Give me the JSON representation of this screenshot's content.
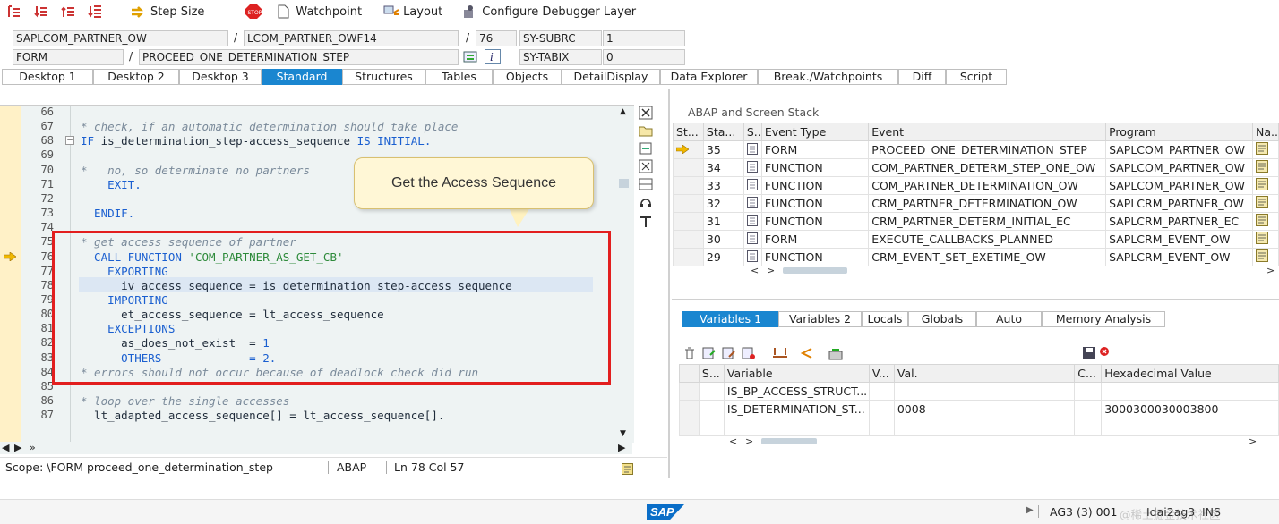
{
  "toolbar": {
    "step_size": "Step Size",
    "watchpoint": "Watchpoint",
    "layout": "Layout",
    "configure_layer": "Configure Debugger Layer"
  },
  "header": {
    "program": "SAPLCOM_PARTNER_OW",
    "include": "LCOM_PARTNER_OWF14",
    "line": "76",
    "sy_subrc_label": "SY-SUBRC",
    "sy_subrc_value": "1",
    "type": "FORM",
    "name": "PROCEED_ONE_DETERMINATION_STEP",
    "sy_tabix_label": "SY-TABIX",
    "sy_tabix_value": "0",
    "sep": "/"
  },
  "desktop_tabs": [
    "Desktop 1",
    "Desktop 2",
    "Desktop 3",
    "Standard",
    "Structures",
    "Tables",
    "Objects",
    "DetailDisplay",
    "Data Explorer",
    "Break./Watchpoints",
    "Diff",
    "Script"
  ],
  "code": {
    "line_numbers": [
      "66",
      "67",
      "68",
      "69",
      "70",
      "71",
      "72",
      "73",
      "74",
      "75",
      "76",
      "77",
      "78",
      "79",
      "80",
      "81",
      "82",
      "83",
      "84",
      "85",
      "86",
      "87"
    ],
    "lines": [
      [],
      [
        {
          "t": "* check, if an automatic determination should take place",
          "c": "cm"
        }
      ],
      [
        {
          "t": "IF ",
          "c": "kw"
        },
        {
          "t": "is_determination_step-access_sequence ",
          "c": ""
        },
        {
          "t": "IS INITIAL.",
          "c": "kw"
        }
      ],
      [],
      [
        {
          "t": "*   no, so determinate no partners",
          "c": "cm"
        }
      ],
      [
        {
          "t": "    EXIT.",
          "c": "kw"
        }
      ],
      [],
      [
        {
          "t": "  ENDIF.",
          "c": "kw"
        }
      ],
      [],
      [
        {
          "t": "* get access sequence of partner",
          "c": "cm"
        }
      ],
      [
        {
          "t": "  CALL FUNCTION ",
          "c": "kw"
        },
        {
          "t": "'COM_PARTNER_AS_GET_CB'",
          "c": "lit"
        }
      ],
      [
        {
          "t": "    EXPORTING",
          "c": "kw"
        }
      ],
      [
        {
          "t": "      iv_access_sequence = is_determination_step-access_sequence",
          "c": ""
        }
      ],
      [
        {
          "t": "    IMPORTING",
          "c": "kw"
        }
      ],
      [
        {
          "t": "      et_access_sequence = lt_access_sequence",
          "c": ""
        }
      ],
      [
        {
          "t": "    EXCEPTIONS",
          "c": "kw"
        }
      ],
      [
        {
          "t": "      as_does_not_exist  = ",
          "c": ""
        },
        {
          "t": "1",
          "c": "num"
        }
      ],
      [
        {
          "t": "      OTHERS             = ",
          "c": "kw"
        },
        {
          "t": "2.",
          "c": "num"
        }
      ],
      [
        {
          "t": "* errors should not occur because of deadlock check did run",
          "c": "cm"
        }
      ],
      [],
      [
        {
          "t": "* loop over the single accesses",
          "c": "cm"
        }
      ],
      [
        {
          "t": "  lt_adapted_access_sequence[] = lt_access_sequence[].",
          "c": ""
        }
      ]
    ]
  },
  "callout": "Get the Access Sequence",
  "status": {
    "scope": "Scope: \\FORM proceed_one_determination_step",
    "lang": "ABAP",
    "pos": "Ln  78 Col  57"
  },
  "stack": {
    "title": "ABAP and Screen Stack",
    "headers": [
      "St...",
      "Sta...",
      "S...",
      "Event Type",
      "Event",
      "Program",
      "Na..."
    ],
    "rows": [
      {
        "level": "35",
        "type": "FORM",
        "event": "PROCEED_ONE_DETERMINATION_STEP",
        "program": "SAPLCOM_PARTNER_OW",
        "current": true
      },
      {
        "level": "34",
        "type": "FUNCTION",
        "event": "COM_PARTNER_DETERM_STEP_ONE_OW",
        "program": "SAPLCOM_PARTNER_OW",
        "current": false
      },
      {
        "level": "33",
        "type": "FUNCTION",
        "event": "COM_PARTNER_DETERMINATION_OW",
        "program": "SAPLCOM_PARTNER_OW",
        "current": false
      },
      {
        "level": "32",
        "type": "FUNCTION",
        "event": "CRM_PARTNER_DETERMINATION_OW",
        "program": "SAPLCRM_PARTNER_OW",
        "current": false
      },
      {
        "level": "31",
        "type": "FUNCTION",
        "event": "CRM_PARTNER_DETERM_INITIAL_EC",
        "program": "SAPLCRM_PARTNER_EC",
        "current": false
      },
      {
        "level": "30",
        "type": "FORM",
        "event": "EXECUTE_CALLBACKS_PLANNED",
        "program": "SAPLCRM_EVENT_OW",
        "current": false
      },
      {
        "level": "29",
        "type": "FUNCTION",
        "event": "CRM_EVENT_SET_EXETIME_OW",
        "program": "SAPLCRM_EVENT_OW",
        "current": false
      }
    ]
  },
  "var_tabs": [
    "Variables 1",
    "Variables 2",
    "Locals",
    "Globals",
    "Auto",
    "Memory Analysis"
  ],
  "vars": {
    "headers": [
      "S...",
      "Variable",
      "V...",
      "Val.",
      "C...",
      "Hexadecimal Value"
    ],
    "rows": [
      {
        "name": "IS_BP_ACCESS_STRUCT...",
        "val": "",
        "hex": ""
      },
      {
        "name": "IS_DETERMINATION_ST...",
        "val": "0008",
        "hex": "3000300030003800"
      }
    ]
  },
  "bottom": {
    "system": "AG3 (3) 001",
    "user": "Idai2ag3",
    "mode": "INS",
    "sap": "SAP",
    "watermark": "@稀土掘金技术社区"
  },
  "colors": {
    "accent": "#1a86d0",
    "highlight_box": "#e21e1e",
    "callout_bg": "#fff7d6"
  }
}
